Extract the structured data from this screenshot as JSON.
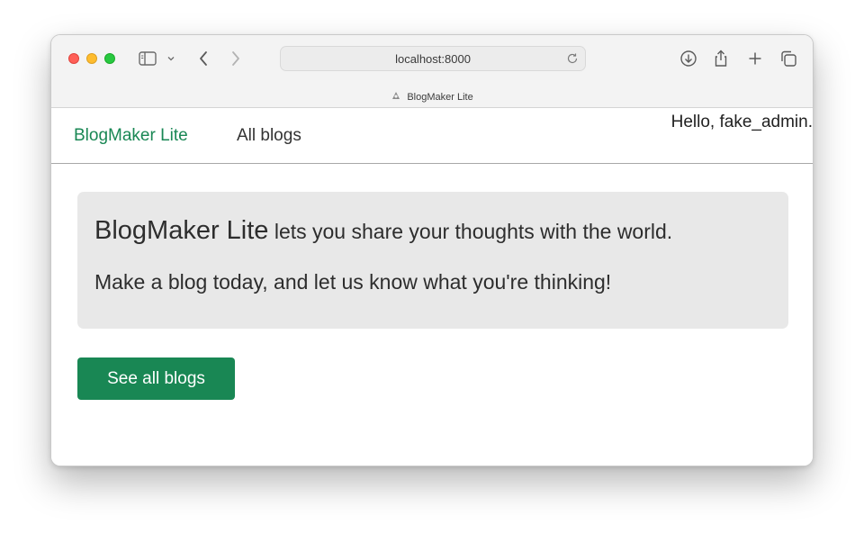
{
  "browser": {
    "address": "localhost:8000",
    "tab_title": "BlogMaker Lite",
    "icons": [
      "sidebar-icon",
      "chevron-down-icon",
      "back-icon",
      "forward-icon",
      "reload-icon",
      "download-icon",
      "share-icon",
      "plus-icon",
      "tabs-overview-icon"
    ]
  },
  "nav": {
    "brand": "BlogMaker Lite",
    "all_blogs": "All blogs",
    "greeting": "Hello, fake_admin."
  },
  "hero": {
    "brand": "BlogMaker Lite",
    "tagline": " lets you share your thoughts with the world.",
    "subtext": "Make a blog today, and let us know what you're thinking!"
  },
  "actions": {
    "see_all_label": "See all blogs"
  },
  "colors": {
    "brand_green": "#198754",
    "hero_bg": "#e8e8e8"
  }
}
